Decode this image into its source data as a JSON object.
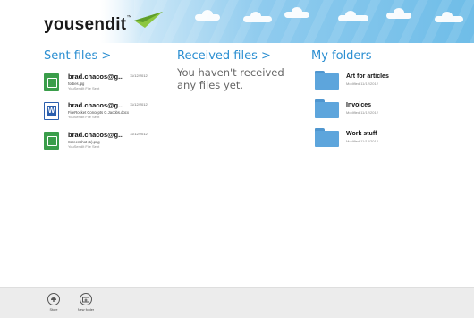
{
  "header": {
    "logo_text": "yousendit",
    "logo_trademark": "™"
  },
  "columns": {
    "sent": {
      "label": "Sent files >"
    },
    "received": {
      "label": "Received files >",
      "empty_message": "You haven't received any files yet."
    },
    "folders": {
      "label": "My folders"
    }
  },
  "sent_files": [
    {
      "sender": "brad.chacos@g...",
      "date": "11/12/2012",
      "filename": "forbes.jpg",
      "status": "YouSendIt File Sent",
      "icon": "image-file-icon"
    },
    {
      "sender": "brad.chacos@g...",
      "date": "11/12/2012",
      "filename": "FireRocket Concepts G Jacobs.docx",
      "status": "YouSendIt File Sent",
      "icon": "word-document-icon"
    },
    {
      "sender": "brad.chacos@g...",
      "date": "11/12/2012",
      "filename": "Screenshot (1).png",
      "status": "YouSendIt File Sent",
      "icon": "image-file-icon"
    }
  ],
  "folders": [
    {
      "name": "Art for articles",
      "modified": "Modified 11/12/2012"
    },
    {
      "name": "Invoices",
      "modified": "Modified 11/12/2012"
    },
    {
      "name": "Work stuff",
      "modified": "Modified 11/12/2012"
    }
  ],
  "appbar": {
    "store_label": "Store",
    "new_folder_label": "New folder"
  },
  "colors": {
    "accent": "#2a8ed1",
    "logo_mark": "#8cc63f",
    "folder": "#5da5dc"
  }
}
